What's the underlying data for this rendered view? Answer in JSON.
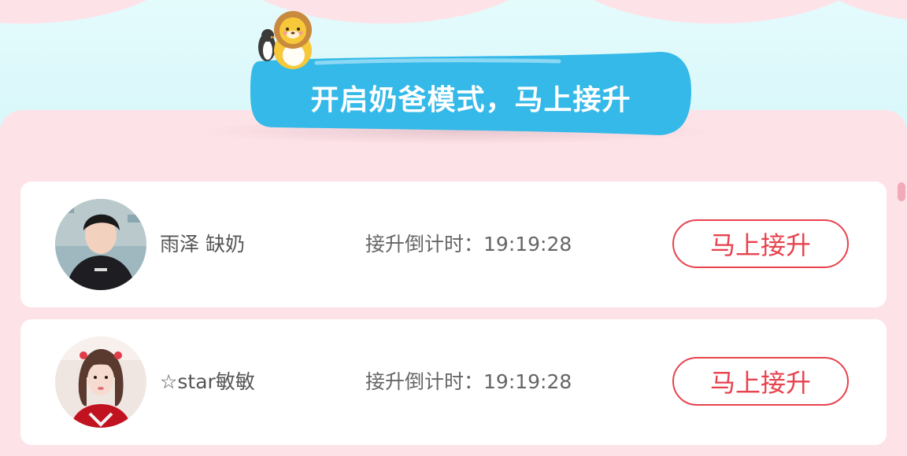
{
  "banner": {
    "title": "开启奶爸模式，马上接升",
    "colors": {
      "banner": "#34b9e8",
      "banner_dark": "#2aa3d6",
      "text": "#ffffff"
    }
  },
  "theme": {
    "sky": "#dff9fb",
    "panel": "#fde2e8",
    "accent": "#e8424d"
  },
  "rows": [
    {
      "name": "雨泽 缺奶",
      "countdown_label": "接升倒计时：",
      "countdown_value": "19:19:28",
      "action_label": "马上接升",
      "avatar_icon": "boy-avatar"
    },
    {
      "name": "☆star敏敏",
      "countdown_label": "接升倒计时：",
      "countdown_value": "19:19:28",
      "action_label": "马上接升",
      "avatar_icon": "girl-avatar"
    }
  ]
}
